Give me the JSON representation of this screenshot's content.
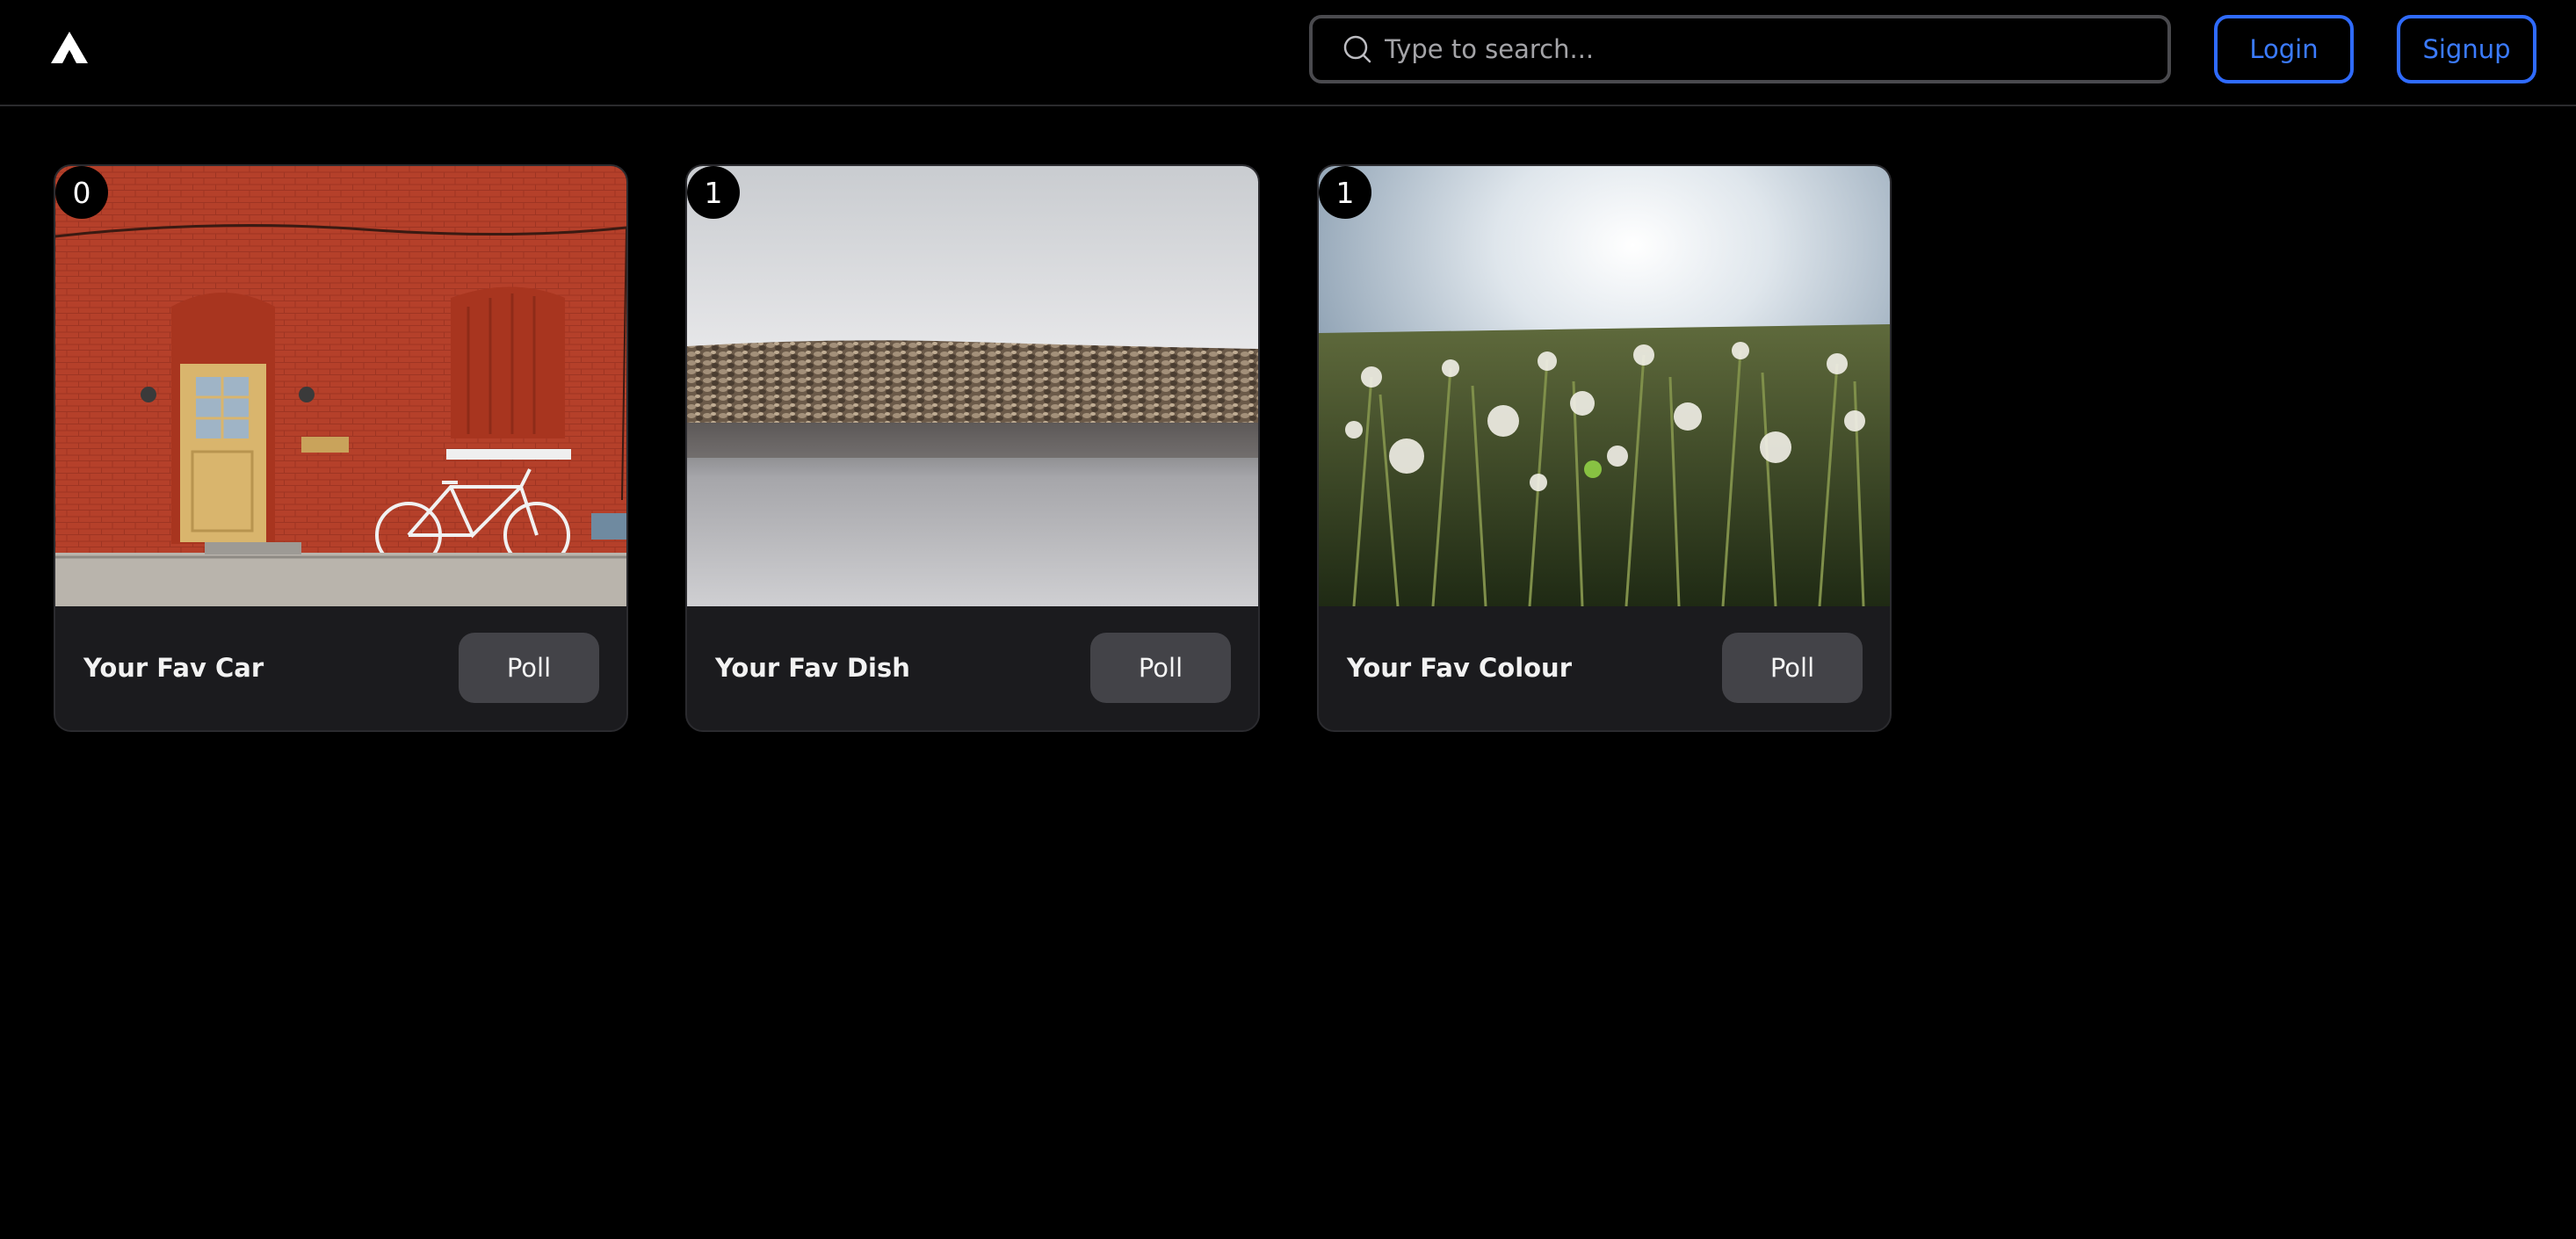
{
  "header": {
    "logo_icon": "triangle-logo-icon",
    "search": {
      "placeholder": "Type to search...",
      "value": "",
      "icon": "search-icon"
    },
    "login_label": "Login",
    "signup_label": "Signup",
    "accent_color": "#3b7bff"
  },
  "cards": [
    {
      "count": "0",
      "title": "Your Fav Car",
      "button_label": "Poll",
      "image": "red brick wall with door and bicycle"
    },
    {
      "count": "1",
      "title": "Your Fav Dish",
      "button_label": "Poll",
      "image": "rocky breakwater over calm water"
    },
    {
      "count": "1",
      "title": "Your Fav Colour",
      "button_label": "Poll",
      "image": "dandelion field at sunrise"
    }
  ]
}
